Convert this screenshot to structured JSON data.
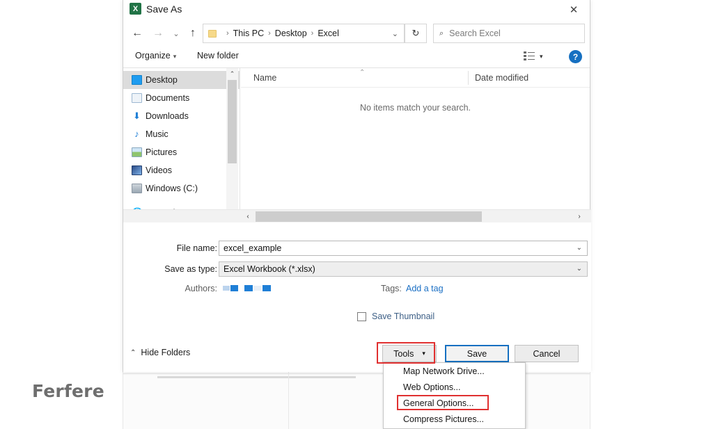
{
  "window": {
    "title": "Save As",
    "app_icon": "excel-icon",
    "app_icon_glyph": "X",
    "close_icon": "✕"
  },
  "nav": {
    "back_icon": "←",
    "forward_icon": "→",
    "recent_icon": "⌄",
    "up_icon": "↑",
    "refresh_icon": "↻",
    "breadcrumb": [
      "This PC",
      "Desktop",
      "Excel"
    ],
    "breadcrumb_sep": "›",
    "breadcrumb_caret": "⌄",
    "search": {
      "icon": "search-icon",
      "glyph": "⌕",
      "placeholder": "Search Excel",
      "value": ""
    }
  },
  "command_bar": {
    "organize": "Organize",
    "organize_caret": "▾",
    "new_folder": "New folder",
    "view_icon": "list-view-icon",
    "view_caret": "▾",
    "help_label": "?"
  },
  "nav_pane": {
    "items": [
      {
        "label": "Desktop",
        "icon": "desktop-icon",
        "selected": true,
        "glyph": ""
      },
      {
        "label": "Documents",
        "icon": "documents-icon",
        "selected": false,
        "glyph": ""
      },
      {
        "label": "Downloads",
        "icon": "downloads-icon",
        "selected": false,
        "glyph": "⬇"
      },
      {
        "label": "Music",
        "icon": "music-icon",
        "selected": false,
        "glyph": "♪"
      },
      {
        "label": "Pictures",
        "icon": "pictures-icon",
        "selected": false,
        "glyph": ""
      },
      {
        "label": "Videos",
        "icon": "videos-icon",
        "selected": false,
        "glyph": ""
      },
      {
        "label": "Windows (C:)",
        "icon": "drive-icon",
        "selected": false,
        "glyph": ""
      },
      {
        "label": "Network",
        "icon": "network-icon",
        "selected": false,
        "glyph": "🌐"
      }
    ],
    "scroll_up_icon": "⌃",
    "scroll_down_icon": "⌄"
  },
  "file_list": {
    "columns": [
      "Name",
      "Date modified"
    ],
    "sort_indicator": "⌃",
    "empty_message": "No items match your search.",
    "rows": []
  },
  "hscroll": {
    "left_icon": "‹",
    "right_icon": "›"
  },
  "form": {
    "file_name_label": "File name:",
    "file_name_value": "excel_example",
    "file_name_caret": "⌄",
    "save_type_label": "Save as type:",
    "save_type_value": "Excel Workbook (*.xlsx)",
    "save_type_caret": "⌄",
    "authors_label": "Authors:",
    "authors_value": "",
    "tags_label": "Tags:",
    "tags_link": "Add a tag",
    "save_thumbnail_label": "Save Thumbnail",
    "save_thumbnail_checked": false
  },
  "footer": {
    "hide_folders_label": "Hide Folders",
    "hide_folders_caret": "⌃",
    "tools_label": "Tools",
    "tools_caret": "▾",
    "save_label": "Save",
    "cancel_label": "Cancel"
  },
  "tools_menu": {
    "items": [
      "Map Network Drive...",
      "Web Options...",
      "General Options...",
      "Compress Pictures..."
    ],
    "highlighted_index": 2
  },
  "annotations": {
    "highlight_color": "#e03030",
    "tools_box_label": "tools-highlight",
    "general_options_box_label": "general-options-highlight"
  },
  "watermark": {
    "text": "Ferfere"
  },
  "colors": {
    "accent": "#1670c1",
    "excel_green": "#217346",
    "link": "#1a6fc4",
    "highlight": "#e03030"
  }
}
